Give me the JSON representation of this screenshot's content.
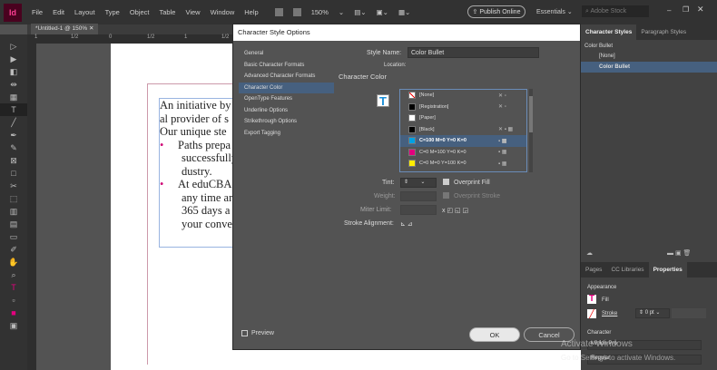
{
  "menubar": {
    "logo": "Id",
    "items": [
      "File",
      "Edit",
      "Layout",
      "Type",
      "Object",
      "Table",
      "View",
      "Window",
      "Help"
    ],
    "zoom": "150%",
    "publish": "Publish Online",
    "workspace": "Essentials",
    "search_placeholder": "Adobe Stock"
  },
  "document": {
    "tab": "*Untitled-1 @ 150%",
    "ruler": [
      "1",
      "1/2",
      "0",
      "1/2",
      "1",
      "1/2"
    ],
    "lines": [
      "An initiative by",
      "al provider of s",
      "Our unique ste"
    ],
    "bullets": [
      {
        "lines": [
          "Paths prepa",
          "successfully",
          "dustry."
        ]
      },
      {
        "lines": [
          "At eduCBA",
          "any time ar",
          "365 days a",
          "your conve"
        ]
      }
    ]
  },
  "dialog": {
    "title": "Character Style Options",
    "nav": [
      "General",
      "Basic Character Formats",
      "Advanced Character Formats",
      "Character Color",
      "OpenType Features",
      "Underline Options",
      "Strikethrough Options",
      "Export Tagging"
    ],
    "selected_nav": "Character Color",
    "style_name_label": "Style Name:",
    "style_name": "Color Bullet",
    "location_label": "Location:",
    "section": "Character Color",
    "swatches": [
      {
        "name": "[None]",
        "color": "none"
      },
      {
        "name": "[Registration]",
        "color": "#000000"
      },
      {
        "name": "[Paper]",
        "color": "#ffffff"
      },
      {
        "name": "[Black]",
        "color": "#000000"
      },
      {
        "name": "C=100 M=0 Y=0 K=0",
        "color": "#00a0e3",
        "selected": true
      },
      {
        "name": "C=0 M=100 Y=0 K=0",
        "color": "#e3007e"
      },
      {
        "name": "C=0 M=0 Y=100 K=0",
        "color": "#ffed00"
      }
    ],
    "tint_label": "Tint:",
    "overprint_fill": "Overprint Fill",
    "weight_label": "Weight:",
    "overprint_stroke": "Overprint Stroke",
    "miter_label": "Miter Limit:",
    "stroke_align_label": "Stroke Alignment:",
    "preview": "Preview",
    "ok": "OK",
    "cancel": "Cancel"
  },
  "panel": {
    "tabs": [
      "Character Styles",
      "Paragraph Styles"
    ],
    "styles": [
      "Color Bullet",
      "[None]",
      "Color Bullet"
    ],
    "bottom_tabs": [
      "Pages",
      "CC Libraries",
      "Properties"
    ],
    "appearance": "Appearance",
    "fill": "Fill",
    "stroke": "Stroke",
    "stroke_weight": "0 pt",
    "character": "Character",
    "font": "Minion Pro",
    "font_style": "Regular"
  },
  "watermark": {
    "line1": "Activate Windows",
    "line2": "Go to Settings to activate Windows."
  }
}
